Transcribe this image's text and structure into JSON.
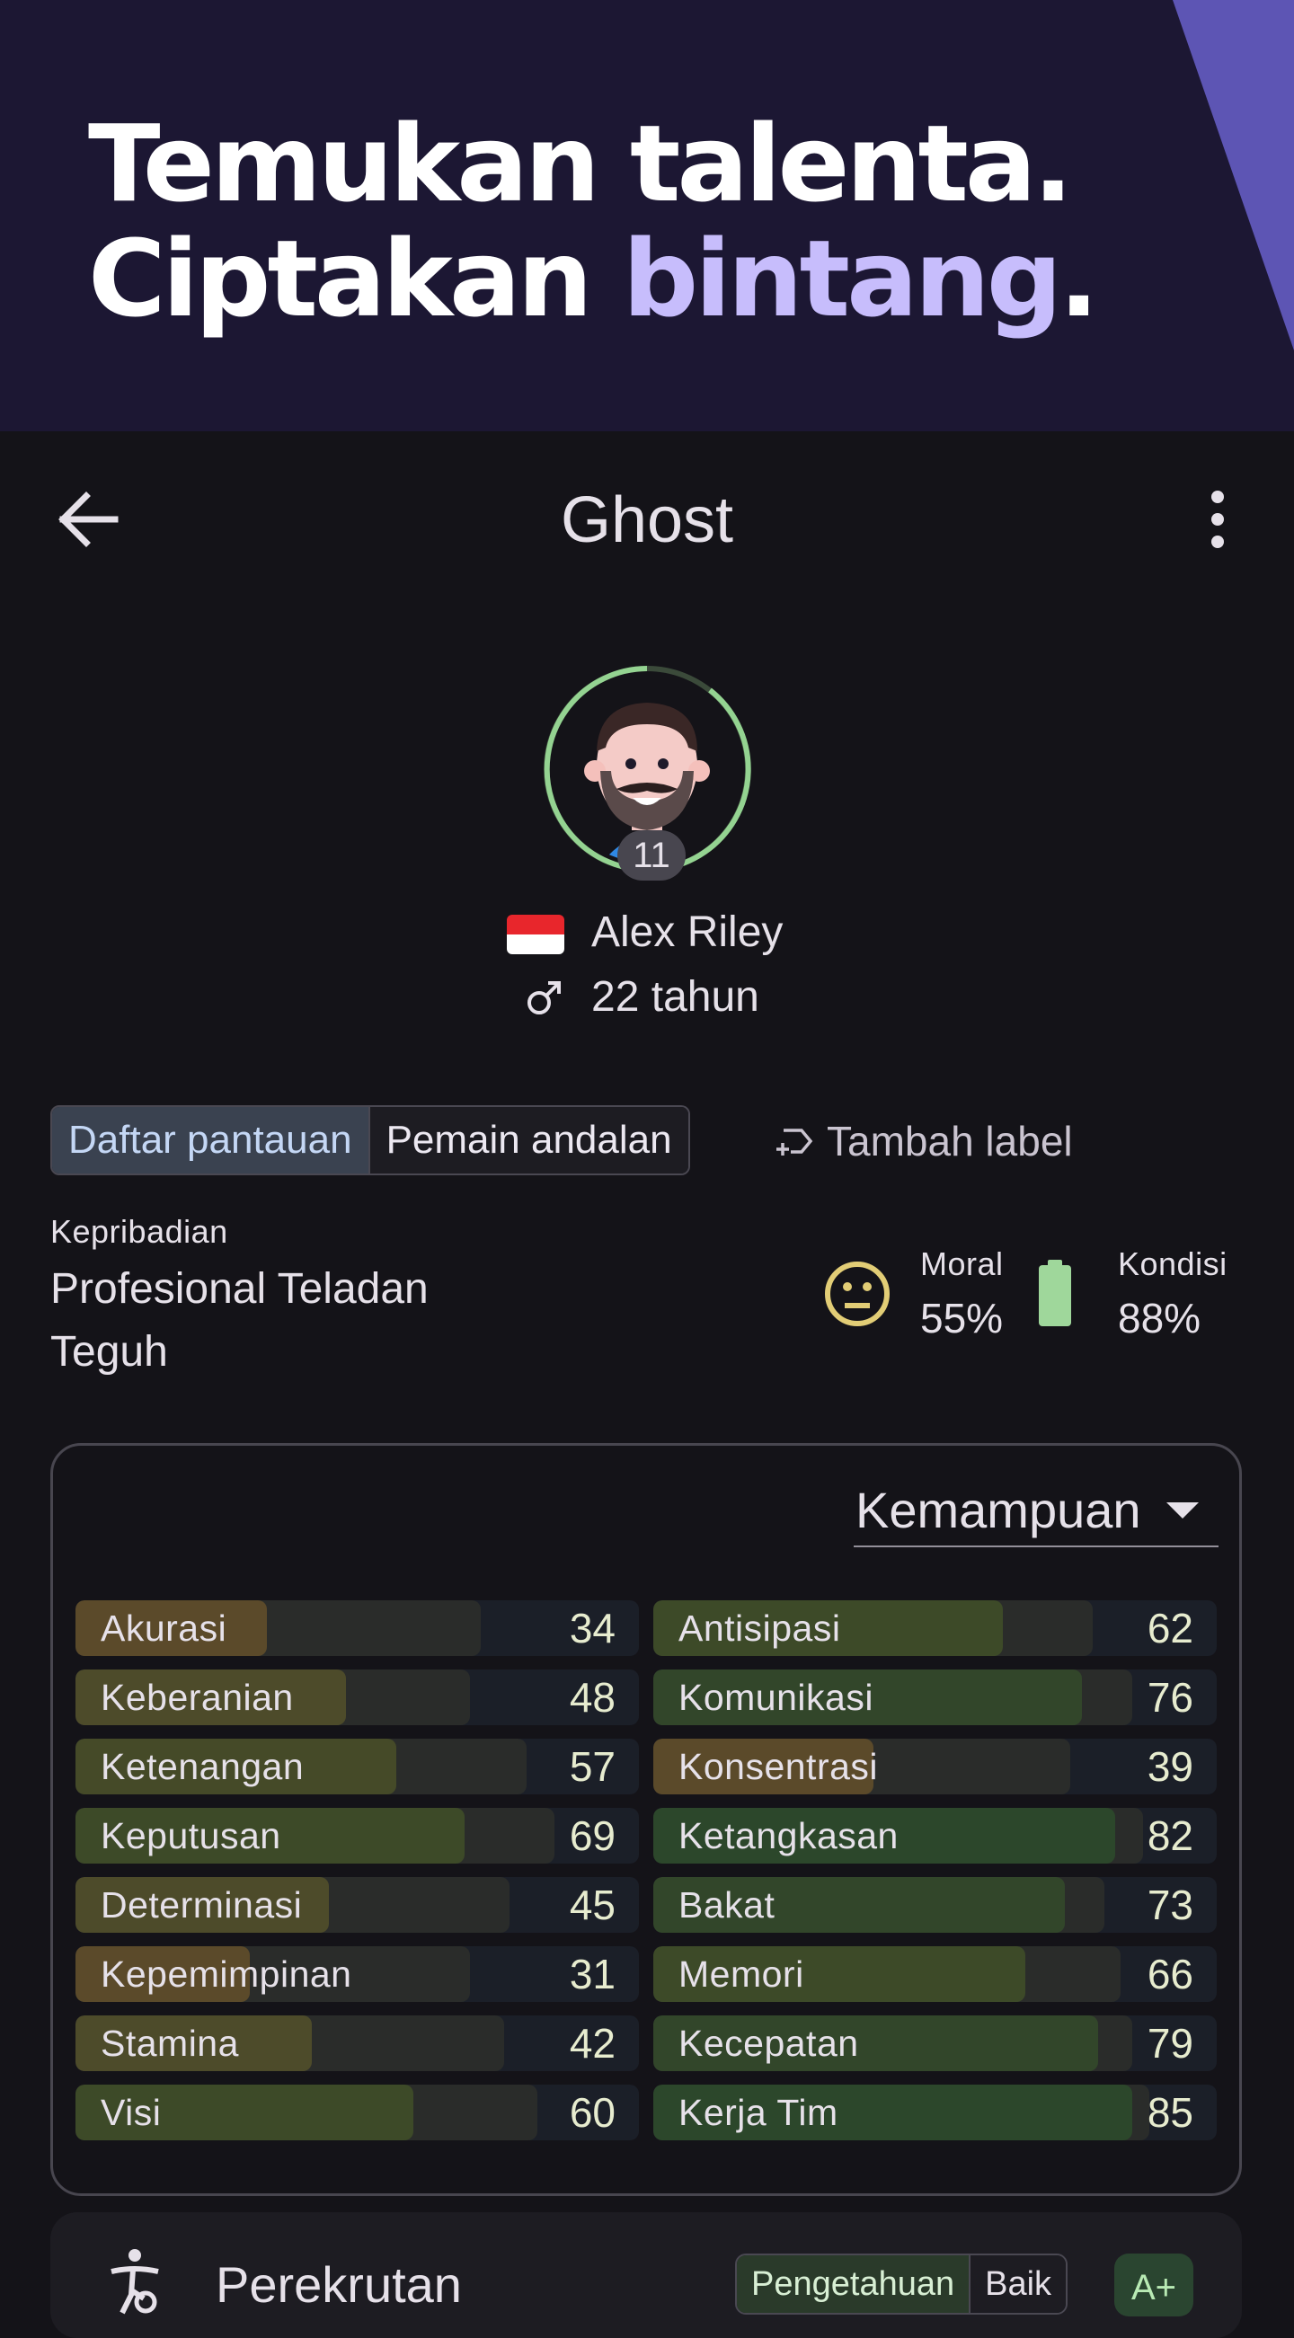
{
  "banner": {
    "line1": "Temukan talenta.",
    "line2_prefix": "Ciptakan ",
    "line2_accent": "bintang",
    "line2_suffix": ".",
    "colors": {
      "background": "#1c1733",
      "accent": "#c7bdfc",
      "stripe": "#5d55b4"
    }
  },
  "appbar": {
    "title": "Ghost",
    "back_icon": "arrow-left-icon",
    "more_icon": "more-vertical-icon"
  },
  "player": {
    "name": "Alex Riley",
    "age": "22 tahun",
    "number": "11",
    "flag": "indonesia-flag",
    "gender_icon": "male-icon",
    "rating_ring_fraction": 0.9
  },
  "labels": {
    "chips": [
      "Daftar pantauan",
      "Pemain andalan"
    ],
    "add_label": "Tambah label",
    "add_label_icon": "label-add-icon"
  },
  "personality": {
    "label": "Kepribadian",
    "value": "Profesional Teladan Teguh"
  },
  "status": {
    "moral_label": "Moral",
    "moral_value": "55%",
    "moral_icon": "neutral-face-icon",
    "kondisi_label": "Kondisi",
    "kondisi_value": "88%",
    "kondisi_icon": "battery-icon"
  },
  "attributes": {
    "dropdown_label": "Kemampuan",
    "left": [
      {
        "name": "Akurasi",
        "value": 34,
        "potential": 72
      },
      {
        "name": "Keberanian",
        "value": 48,
        "potential": 70
      },
      {
        "name": "Ketenangan",
        "value": 57,
        "potential": 80
      },
      {
        "name": "Keputusan",
        "value": 69,
        "potential": 85
      },
      {
        "name": "Determinasi",
        "value": 45,
        "potential": 77
      },
      {
        "name": "Kepemimpinan",
        "value": 31,
        "potential": 70
      },
      {
        "name": "Stamina",
        "value": 42,
        "potential": 76
      },
      {
        "name": "Visi",
        "value": 60,
        "potential": 82
      }
    ],
    "right": [
      {
        "name": "Antisipasi",
        "value": 62,
        "potential": 78
      },
      {
        "name": "Komunikasi",
        "value": 76,
        "potential": 85
      },
      {
        "name": "Konsentrasi",
        "value": 39,
        "potential": 74
      },
      {
        "name": "Ketangkasan",
        "value": 82,
        "potential": 87
      },
      {
        "name": "Bakat",
        "value": 73,
        "potential": 80
      },
      {
        "name": "Memori",
        "value": 66,
        "potential": 83
      },
      {
        "name": "Kecepatan",
        "value": 79,
        "potential": 85
      },
      {
        "name": "Kerja Tim",
        "value": 85,
        "potential": 88
      }
    ]
  },
  "recruitment": {
    "title": "Perekrutan",
    "icon": "scout-icon",
    "knowledge_label": "Pengetahuan",
    "knowledge_value": "Baik",
    "grade": "A+"
  }
}
